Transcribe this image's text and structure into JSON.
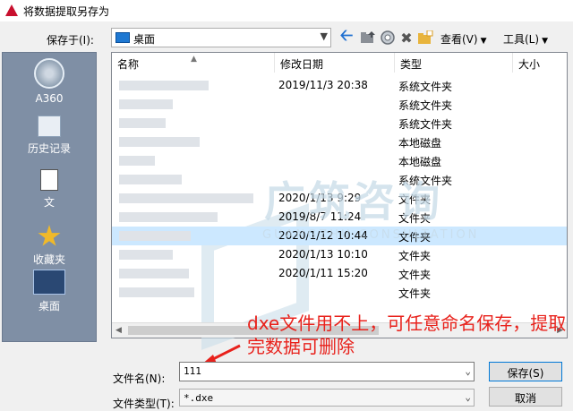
{
  "window": {
    "title": "将数据提取另存为"
  },
  "toolbar": {
    "save_in_label": "保存于(I):",
    "save_in_value": "桌面",
    "view_label": "查看(V)",
    "tools_label": "工具(L)"
  },
  "places": [
    {
      "label": "A360"
    },
    {
      "label": "历史记录"
    },
    {
      "label": "文"
    },
    {
      "label": "收藏夹"
    },
    {
      "label": "桌面"
    }
  ],
  "columns": [
    "名称",
    "修改日期",
    "类型",
    "大小"
  ],
  "rows": [
    {
      "date": "2019/11/3 20:38",
      "type": "系统文件夹"
    },
    {
      "date": "",
      "type": "系统文件夹"
    },
    {
      "date": "",
      "type": "系统文件夹"
    },
    {
      "date": "",
      "type": "本地磁盘"
    },
    {
      "date": "",
      "type": "本地磁盘"
    },
    {
      "date": "",
      "type": "系统文件夹"
    },
    {
      "date": "2020/1/13 9:29",
      "type": "文件夹"
    },
    {
      "date": "2019/8/7 11:24",
      "type": "文件夹"
    },
    {
      "date": "2020/1/12 10:44",
      "type": "文件夹"
    },
    {
      "date": "2020/1/13 10:10",
      "type": "文件夹"
    },
    {
      "date": "2020/1/11 15:20",
      "type": "文件夹"
    },
    {
      "date": "",
      "type": "文件夹"
    }
  ],
  "watermark": {
    "main": "广筑咨询",
    "sub": "GUANGZHU CONSULTATION"
  },
  "annotation": {
    "text": "dxe文件用不上，可任意命名保存，提取完数据可删除"
  },
  "form": {
    "filename_label": "文件名(N):",
    "filename_value": "111",
    "filetype_label": "文件类型(T):",
    "filetype_value": "*.dxe",
    "save_button": "保存(S)",
    "cancel_button": "取消"
  },
  "colors": {
    "accent": "#1e6fd0",
    "annotation": "#e8211b",
    "highlight_row": "#cce8ff",
    "places_bg": "#7f8fa5"
  }
}
